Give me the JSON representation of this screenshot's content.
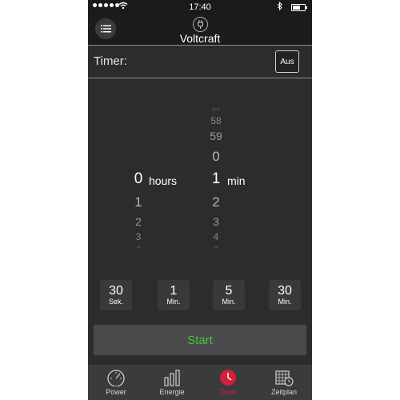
{
  "status_bar": {
    "time": "17:40"
  },
  "header": {
    "title": "Voltcraft"
  },
  "timer": {
    "label": "Timer:",
    "toggle_label": "Aus"
  },
  "picker": {
    "hours_label": "hours",
    "min_label": "min",
    "selected_hours": "0",
    "selected_min": "1",
    "hours_values_after": [
      "1",
      "2",
      "3",
      "4"
    ],
    "min_values_before": [
      "57",
      "58",
      "59",
      "0"
    ],
    "min_values_after": [
      "2",
      "3",
      "4",
      "5"
    ]
  },
  "quick_buttons": [
    {
      "value": "30",
      "unit": "Sek."
    },
    {
      "value": "1",
      "unit": "Min."
    },
    {
      "value": "5",
      "unit": "Min."
    },
    {
      "value": "30",
      "unit": "Min."
    }
  ],
  "start_label": "Start",
  "tabs": [
    {
      "label": "Power",
      "icon": "gauge-icon"
    },
    {
      "label": "Energie",
      "icon": "bar-chart-icon"
    },
    {
      "label": "Timer",
      "icon": "timer-icon",
      "active": true
    },
    {
      "label": "Zeitplan",
      "icon": "calendar-clock-icon"
    }
  ],
  "colors": {
    "accent": "#d41f3a",
    "start_text": "#3ec93e",
    "background": "#2b2c2e"
  }
}
